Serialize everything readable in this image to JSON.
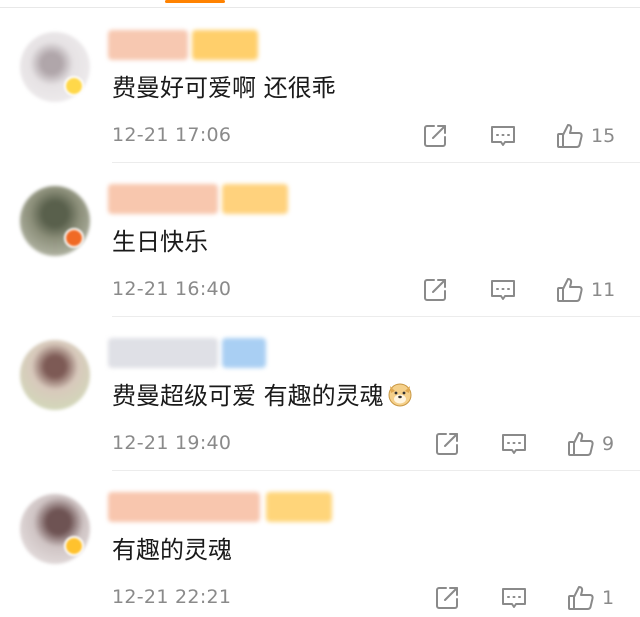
{
  "comments": [
    {
      "text": "费曼好可爱啊  还很乖",
      "time": "12-21 17:06",
      "likes": "15",
      "colors": {
        "avatar_bg": "#e6e2e4",
        "avatar_mid": "#b0a6aa",
        "badge": "#ffd84a",
        "name_a": "#f7c8b1",
        "name_b": "#ffcf6b"
      }
    },
    {
      "text": "生日快乐",
      "time": "12-21 16:40",
      "likes": "11",
      "colors": {
        "avatar_bg": "#8c8f7a",
        "avatar_mid": "#59604c",
        "badge": "#f06a25",
        "name_a": "#f8c7ae",
        "name_b": "#ffd27d"
      }
    },
    {
      "text": "费曼超级可爱 有趣的灵魂",
      "time": "12-21 19:40",
      "likes": "9",
      "emoji": "dog-face-emoji",
      "colors": {
        "avatar_bg": "#d8c9bc",
        "avatar_mid": "#7d5a55",
        "badge": "#ffffff",
        "name_a": "#dfe0e6",
        "name_b": "#a9cff3"
      }
    },
    {
      "text": "有趣的灵魂",
      "time": "12-21 22:21",
      "likes": "1",
      "colors": {
        "avatar_bg": "#cfc4c4",
        "avatar_mid": "#6e5353",
        "badge": "#ffc22e",
        "name_a": "#f8c6ae",
        "name_b": "#ffd57a"
      }
    }
  ],
  "icons": {
    "share": "share-icon",
    "comment": "comment-icon",
    "like": "thumbs-up-icon"
  },
  "colors": {
    "accent": "#ff8200",
    "text": "#1a1a1a",
    "meta": "#8a8a8a",
    "icon": "#8a8a8a"
  }
}
